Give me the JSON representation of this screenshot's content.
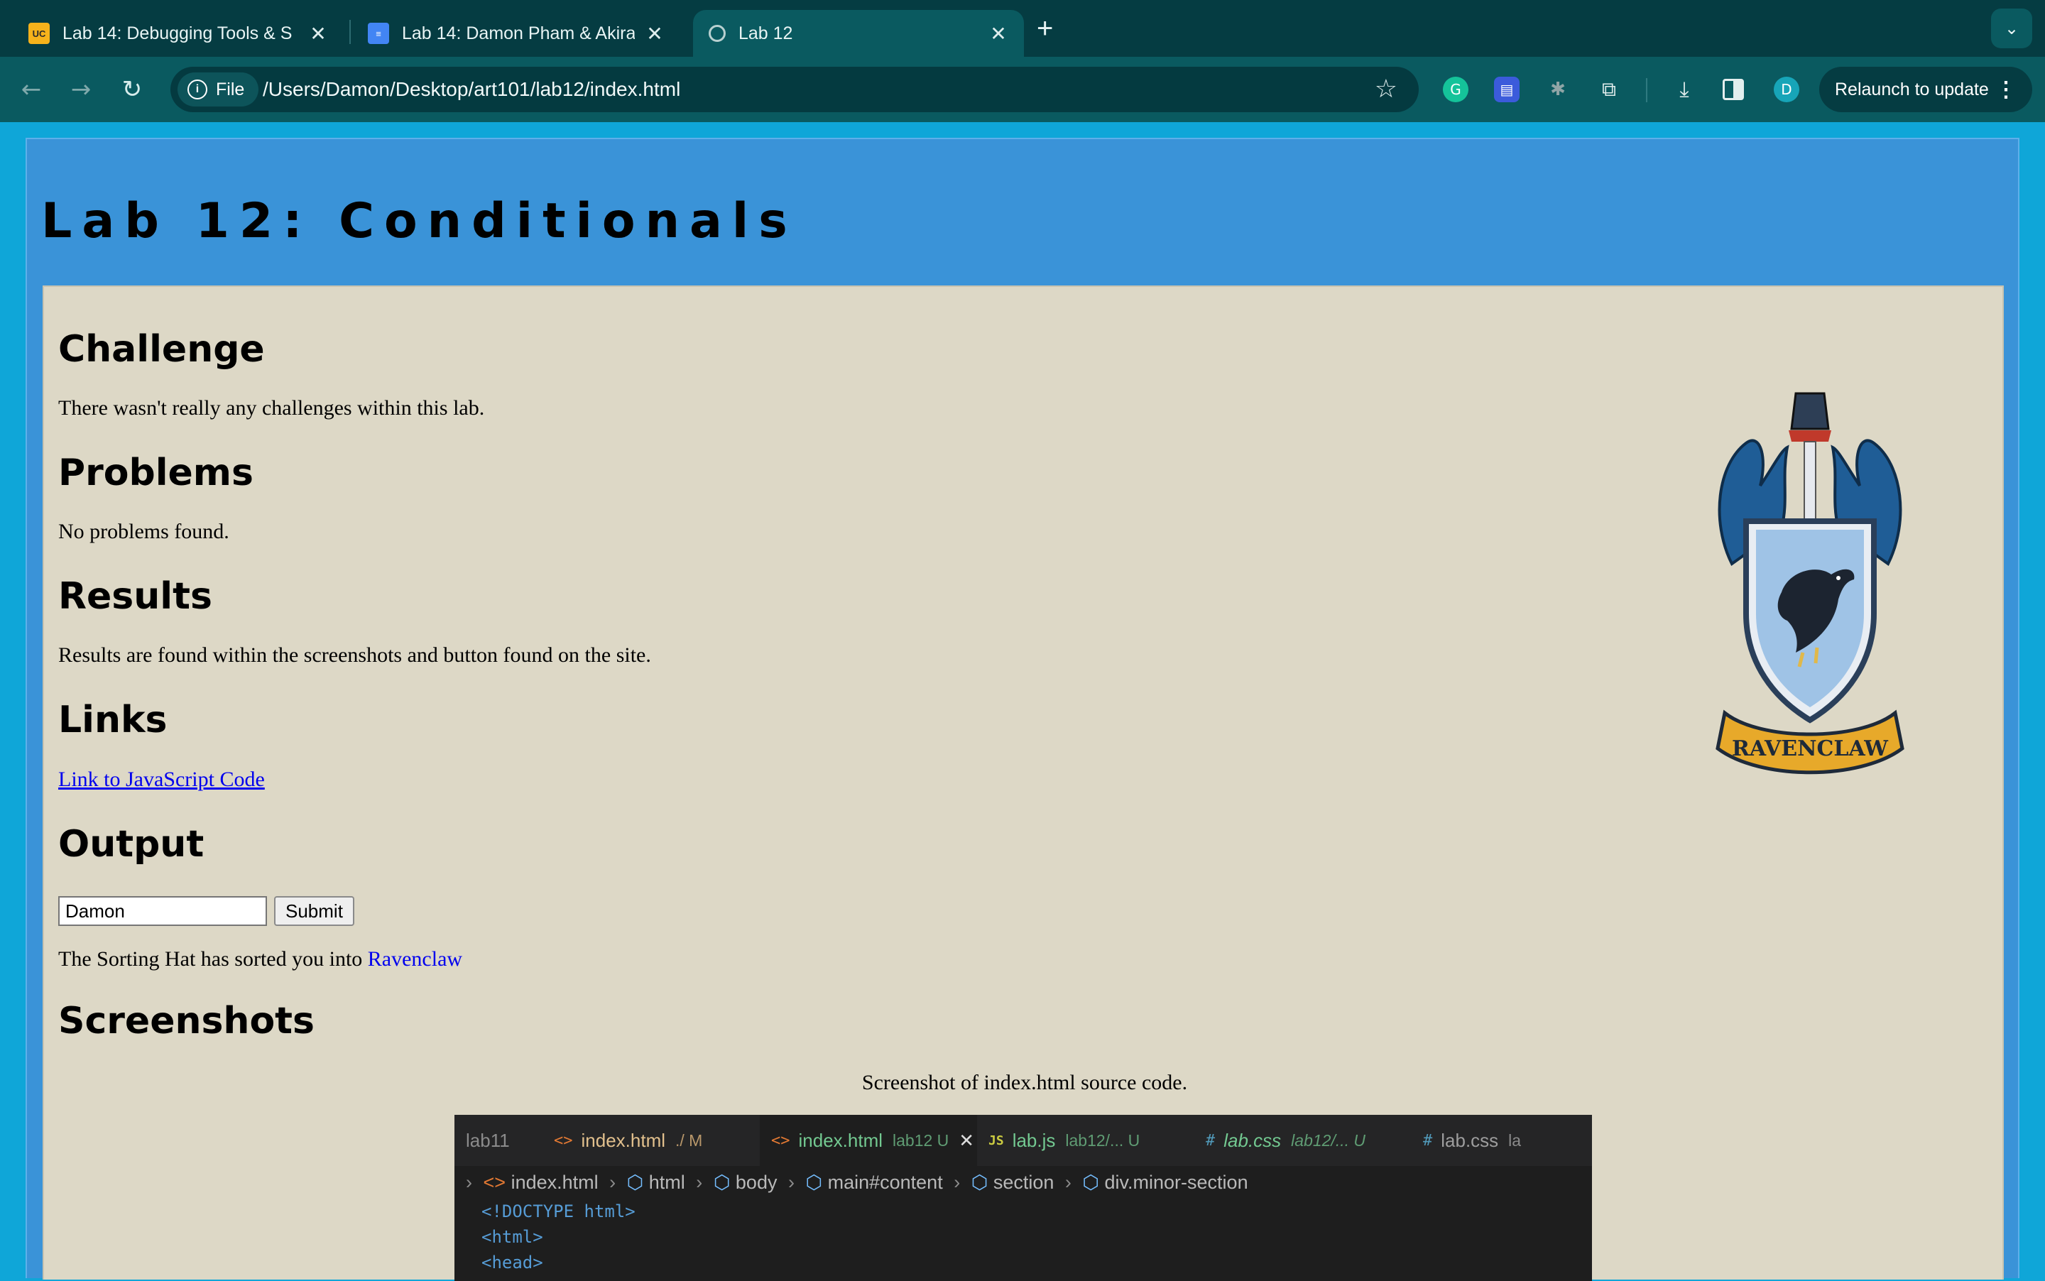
{
  "browser": {
    "tabs": [
      {
        "title": "Lab 14: Debugging Tools & S",
        "icon": "ucsc-favicon"
      },
      {
        "title": "Lab 14: Damon Pham & Akira",
        "icon": "google-docs-favicon"
      },
      {
        "title": "Lab 12",
        "icon": "globe-favicon",
        "active": true
      }
    ],
    "file_chip": "File",
    "url": "/Users/Damon/Desktop/art101/lab12/index.html",
    "profile_initial": "D",
    "relaunch_label": "Relaunch to update"
  },
  "page": {
    "title": "Lab 12: Conditionals",
    "sections": {
      "challenge": {
        "heading": "Challenge",
        "text": "There wasn't really any challenges within this lab."
      },
      "problems": {
        "heading": "Problems",
        "text": "No problems found."
      },
      "results": {
        "heading": "Results",
        "text": "Results are found within the screenshots and button found on the site."
      },
      "links": {
        "heading": "Links",
        "link_text": "Link to JavaScript Code"
      },
      "output": {
        "heading": "Output",
        "input_value": "Damon",
        "submit_label": "Submit",
        "result_prefix": "The Sorting Hat has sorted you into",
        "house": "Ravenclaw"
      },
      "screenshots": {
        "heading": "Screenshots",
        "caption": "Screenshot of index.html source code."
      }
    },
    "crest_banner": "RAVENCLAW"
  },
  "editor": {
    "tabs": [
      {
        "name": "lab11",
        "sub": ""
      },
      {
        "name": "index.html",
        "sub": "./ M"
      },
      {
        "name": "index.html",
        "sub": "lab12 U",
        "active": true
      },
      {
        "name": "lab.js",
        "sub": "lab12/... U"
      },
      {
        "name": "lab.css",
        "sub": "lab12/... U"
      },
      {
        "name": "lab.css",
        "sub": "la"
      }
    ],
    "breadcrumbs": [
      "index.html",
      "html",
      "body",
      "main#content",
      "section",
      "div.minor-section"
    ],
    "code": [
      "<!DOCTYPE html>",
      "<html>",
      "<head>"
    ]
  },
  "colors": {
    "tabstrip": "#053c42",
    "toolbar": "#0a5a60",
    "page_header": "#3a93d8",
    "content_bg": "#ddd8c6",
    "link": "#0000ee"
  }
}
